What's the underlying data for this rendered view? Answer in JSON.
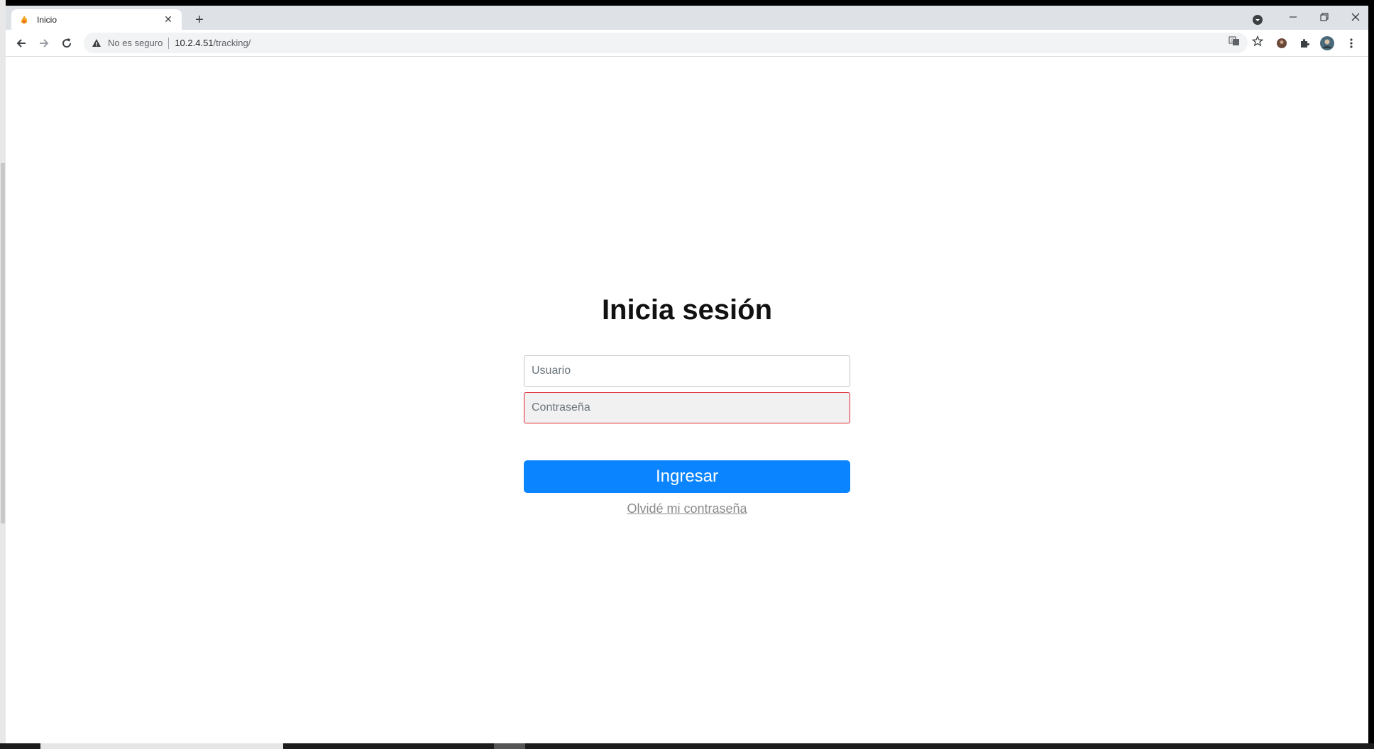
{
  "browser": {
    "tab": {
      "title": "Inicio",
      "favicon": "flame-icon",
      "accent": "#f5a623"
    },
    "toolbar": {
      "security_text": "No es seguro",
      "url_host": "10.2.4.51",
      "url_path": "/tracking/"
    },
    "icons": [
      "back-arrow-icon",
      "forward-arrow-icon",
      "reload-icon",
      "warning-icon",
      "translate-icon",
      "star-icon",
      "profile-icon",
      "extensions-icon",
      "avatar",
      "menu-icon"
    ]
  },
  "login": {
    "title": "Inicia sesión",
    "username_placeholder": "Usuario",
    "password_placeholder": "Contraseña",
    "submit_label": "Ingresar",
    "forgot_label": "Olvidé mi contraseña",
    "colors": {
      "primary": "#0a84ff",
      "error_border": "#e0242f"
    }
  }
}
